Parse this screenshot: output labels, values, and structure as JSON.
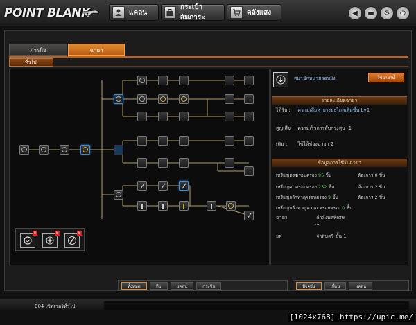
{
  "app": {
    "logo": "POINT BLANK"
  },
  "topnav": [
    {
      "label": "แคลน",
      "icon": "user-icon"
    },
    {
      "label": "กระเป๋าสัมภาระ",
      "icon": "bag-icon"
    },
    {
      "label": "คลังแสง",
      "icon": "cart-icon"
    }
  ],
  "window_controls": [
    "back-icon",
    "minimize-icon",
    "settings-icon",
    "power-icon"
  ],
  "tabs": {
    "missions": "ภารกิจ",
    "titles": "ฉายา"
  },
  "subtab": "ทั่วไป",
  "owned_title_icons": [
    "badge-ring-icon",
    "badge-compass-icon",
    "badge-knife-icon"
  ],
  "info": {
    "skill_name": "สมาชิกหน่วยลอบยิง",
    "use_button": "ใช้ฉายานี้",
    "detail_header": "รายละเอียดฉายา",
    "bonus_label": "ได้รับ :",
    "bonus_value": "ความเสียหายระยะไกลเพิ่มขึ้น Lv1",
    "penalty_label": "สูญเสีย :",
    "penalty_value": "ความเร็วการสับกระสุน -1",
    "slot_label": "เพิ่ม :",
    "slot_value": "ใช้ได้ช่องฉายา 2",
    "req_header": "ข้อมูลการใช้รับฉายา",
    "requirements": [
      {
        "label": "เหรียญตรา",
        "have_prefix": "ครอบครอง",
        "have": "95",
        "unit": "ชิ้น",
        "need": "ต้องการ 0 ชิ้น"
      },
      {
        "label": "เหรียญศ",
        "have_prefix": "ครอบครอง",
        "have": "232",
        "unit": "ชิ้น",
        "need": "ต้องการ 2 ชิ้น"
      },
      {
        "label": "เหรียญกล้าหาญ",
        "have_prefix": "ครอบครอง",
        "have": "9",
        "unit": "ชิ้น",
        "need": "ต้องการ 2 ชิ้น"
      },
      {
        "label": "เหรียญกล้าหาญความ",
        "have_prefix": "ครอบครอง",
        "have": "0",
        "unit": "ชิ้น",
        "need": ""
      }
    ],
    "title_label": "ฉายา",
    "title_value": "กำลังพลพิเศษ",
    "title_dots": "....",
    "rank_label": "ยศ",
    "rank_value": "จ่าสิบตรี ชั้น 1"
  },
  "bottom_left_tabs": [
    "ทั้งหมด",
    "ทีม",
    "แคลน",
    "กระซิบ"
  ],
  "bottom_right_tabs": [
    "ปัจจุบัน",
    "เพื่อน",
    "แคลน"
  ],
  "status": {
    "text": "004 เซิฟเวอร์ทั่วไป"
  },
  "watermark": "[1024x768] https://upic.me/"
}
